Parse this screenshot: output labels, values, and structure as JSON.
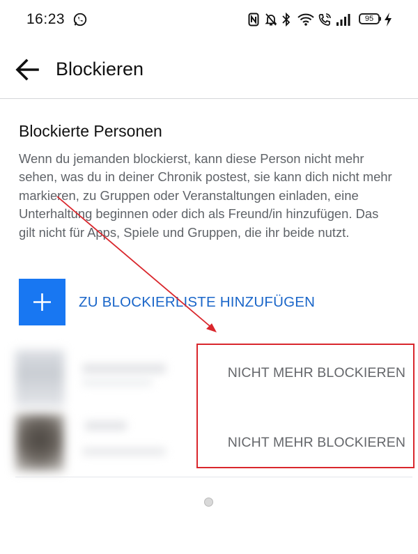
{
  "status_bar": {
    "time": "16:23",
    "battery": "95",
    "icons": [
      "whatsapp-icon",
      "nfc-icon",
      "mute-icon",
      "bluetooth-icon",
      "wifi-icon",
      "wifi-calling-icon",
      "signal-icon",
      "battery-icon",
      "charging-icon"
    ]
  },
  "header": {
    "title": "Blockieren",
    "back_icon": "arrow-left-icon"
  },
  "section": {
    "title": "Blockierte Personen",
    "description": "Wenn du jemanden blockierst, kann diese Person nicht mehr sehen, was du in deiner Chronik postest, sie kann dich nicht mehr markieren, zu Gruppen oder Veranstaltungen einladen, eine Unterhaltung beginnen oder dich als Freund/in hinzufügen. Das gilt nicht für Apps, Spiele und Gruppen, die ihr beide nutzt."
  },
  "add_button": {
    "label": "ZU BLOCKIERLISTE HINZUFÜGEN",
    "icon": "plus-icon"
  },
  "blocked_list": [
    {
      "unblock_label": "NICHT MEHR BLOCKIEREN"
    },
    {
      "unblock_label": "NICHT MEHR BLOCKIEREN"
    }
  ],
  "colors": {
    "accent": "#1877f2",
    "link_text": "#1a66c9",
    "annotation": "#d9262c",
    "secondary_text": "#65676b"
  }
}
